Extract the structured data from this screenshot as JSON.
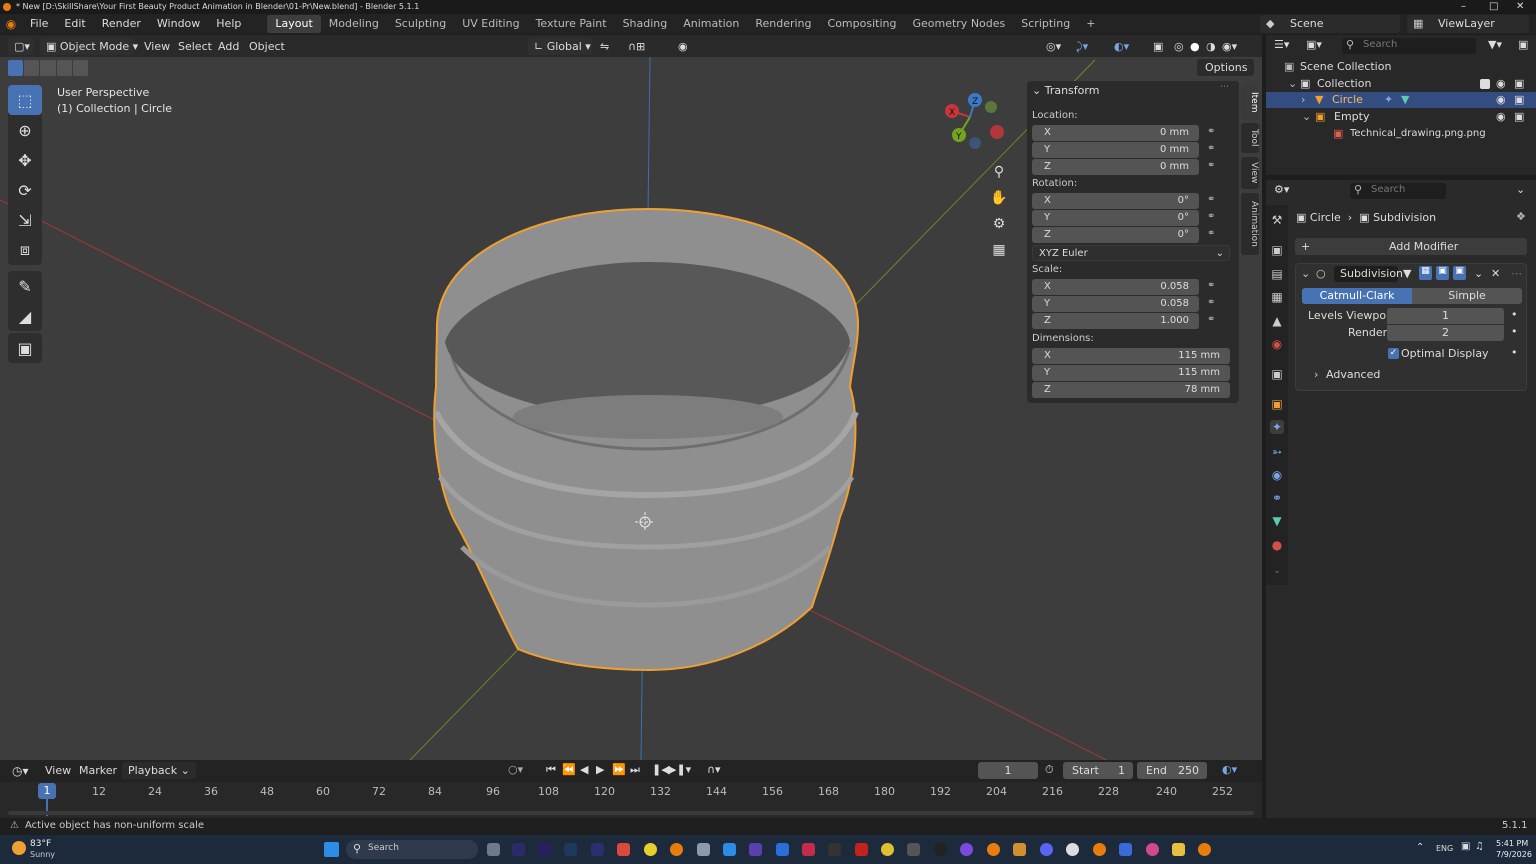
{
  "window": {
    "title": "* New [D:\\SkillShare\\Your First Beauty Product Animation in Blender\\01-Pr\\New.blend] - Blender 5.1.1",
    "version": "5.1.1"
  },
  "menu": {
    "items": [
      "File",
      "Edit",
      "Render",
      "Window",
      "Help"
    ],
    "workspaces": [
      "Layout",
      "Modeling",
      "Sculpting",
      "UV Editing",
      "Texture Paint",
      "Shading",
      "Animation",
      "Rendering",
      "Compositing",
      "Geometry Nodes",
      "Scripting"
    ],
    "active_workspace": "Layout",
    "add_tab": "+",
    "scene": "Scene",
    "view_layer": "ViewLayer"
  },
  "viewport_header": {
    "mode": "Object Mode",
    "menus": [
      "View",
      "Select",
      "Add",
      "Object"
    ],
    "orientation": "Global",
    "options_label": "Options"
  },
  "viewport": {
    "view_name": "User Perspective",
    "collection_info": "(1) Collection | Circle",
    "gizmo_axes": [
      "X",
      "Y",
      "Z"
    ]
  },
  "npanel": {
    "section": "Transform",
    "location_label": "Location:",
    "location": [
      {
        "axis": "X",
        "value": "0 mm"
      },
      {
        "axis": "Y",
        "value": "0 mm"
      },
      {
        "axis": "Z",
        "value": "0 mm"
      }
    ],
    "rotation_label": "Rotation:",
    "rotation": [
      {
        "axis": "X",
        "value": "0°"
      },
      {
        "axis": "Y",
        "value": "0°"
      },
      {
        "axis": "Z",
        "value": "0°"
      }
    ],
    "rotation_mode": "XYZ Euler",
    "scale_label": "Scale:",
    "scale": [
      {
        "axis": "X",
        "value": "0.058"
      },
      {
        "axis": "Y",
        "value": "0.058"
      },
      {
        "axis": "Z",
        "value": "1.000"
      }
    ],
    "dimensions_label": "Dimensions:",
    "dimensions": [
      {
        "axis": "X",
        "value": "115 mm"
      },
      {
        "axis": "Y",
        "value": "115 mm"
      },
      {
        "axis": "Z",
        "value": "78 mm"
      }
    ],
    "tabs": [
      "Item",
      "Tool",
      "View",
      "Animation"
    ]
  },
  "timeline": {
    "menus": [
      "View",
      "Marker",
      "Playback"
    ],
    "current_frame": "1",
    "start_label": "Start",
    "start": "1",
    "end_label": "End",
    "end": "250",
    "ruler": [
      "1",
      "12",
      "24",
      "36",
      "48",
      "60",
      "72",
      "84",
      "96",
      "108",
      "120",
      "132",
      "144",
      "156",
      "168",
      "180",
      "192",
      "204",
      "216",
      "228",
      "240",
      "252"
    ]
  },
  "outliner": {
    "search_placeholder": "Search",
    "items": [
      {
        "label": "Scene Collection"
      },
      {
        "label": "Collection"
      },
      {
        "label": "Circle"
      },
      {
        "label": "Empty"
      },
      {
        "label": "Technical_drawing.png.png"
      }
    ]
  },
  "properties": {
    "search_placeholder": "Search",
    "breadcrumb_object": "Circle",
    "breadcrumb_modifier": "Subdivision",
    "add_modifier": "Add Modifier",
    "modifier_name": "Subdivision",
    "type_catmull": "Catmull-Clark",
    "type_simple": "Simple",
    "levels_viewport_label": "Levels Viewport",
    "levels_viewport": "1",
    "render_label": "Render",
    "render": "2",
    "optimal_display": "Optimal Display",
    "advanced": "Advanced"
  },
  "status": {
    "message": "Active object has non-uniform scale",
    "version": "5.1.1"
  },
  "taskbar": {
    "weather_temp": "83°F",
    "weather_desc": "Sunny",
    "search": "Search",
    "lang": "ENG",
    "time": "5:41 PM",
    "date": "7/9/2026"
  },
  "colors": {
    "accent": "#4772b3",
    "selection": "#f0a030",
    "viewport_bg": "#3d3d3d",
    "x_axis": "#c8363a",
    "y_axis": "#75a31f",
    "z_axis": "#3c78c8"
  }
}
